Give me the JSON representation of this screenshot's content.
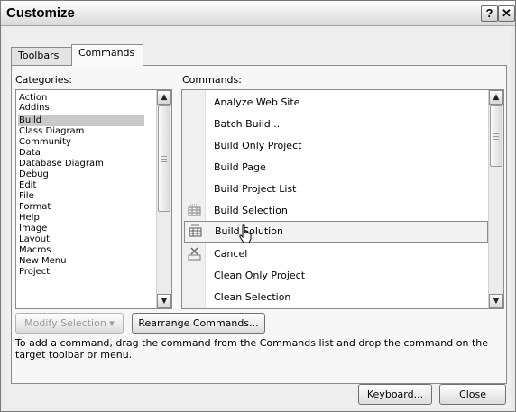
{
  "window": {
    "title": "Customize",
    "help_glyph": "?",
    "close_glyph": "✕"
  },
  "tabs": [
    {
      "label": "Toolbars"
    },
    {
      "label": "Commands",
      "selected": true
    }
  ],
  "categories": {
    "label": "Categories:",
    "selected": "Build",
    "items": [
      "Action",
      "Addins",
      "Build",
      "Class Diagram",
      "Community",
      "Data",
      "Database Diagram",
      "Debug",
      "Edit",
      "File",
      "Format",
      "Help",
      "Image",
      "Layout",
      "Macros",
      "New Menu",
      "Project"
    ]
  },
  "commands": {
    "label": "Commands:",
    "highlighted": "Build Solution",
    "items": [
      {
        "label": "Analyze Web Site",
        "icon": ""
      },
      {
        "label": "Batch Build...",
        "icon": ""
      },
      {
        "label": "Build Only Project",
        "icon": ""
      },
      {
        "label": "Build Page",
        "icon": ""
      },
      {
        "label": "Build Project List",
        "icon": ""
      },
      {
        "label": "Build Selection",
        "icon": "build-selection-icon"
      },
      {
        "label": "Build Solution",
        "icon": "build-solution-icon"
      },
      {
        "label": "Cancel",
        "icon": "cancel-build-icon"
      },
      {
        "label": "Clean Only Project",
        "icon": ""
      },
      {
        "label": "Clean Selection",
        "icon": ""
      }
    ]
  },
  "buttons": {
    "modify_selection": "Modify Selection",
    "modify_selection_arrow": "▾",
    "rearrange_commands": "Rearrange Commands...",
    "keyboard": "Keyboard...",
    "close": "Close"
  },
  "hint_text": "To add a command, drag the command from the Commands list and drop the command on the target toolbar or menu.",
  "scroll_arrows": {
    "up": "▲",
    "down": "▼"
  },
  "colors": {
    "selection": "#c9c9c9",
    "dialog_bg": "#efefef",
    "border": "#8c8c8c"
  }
}
